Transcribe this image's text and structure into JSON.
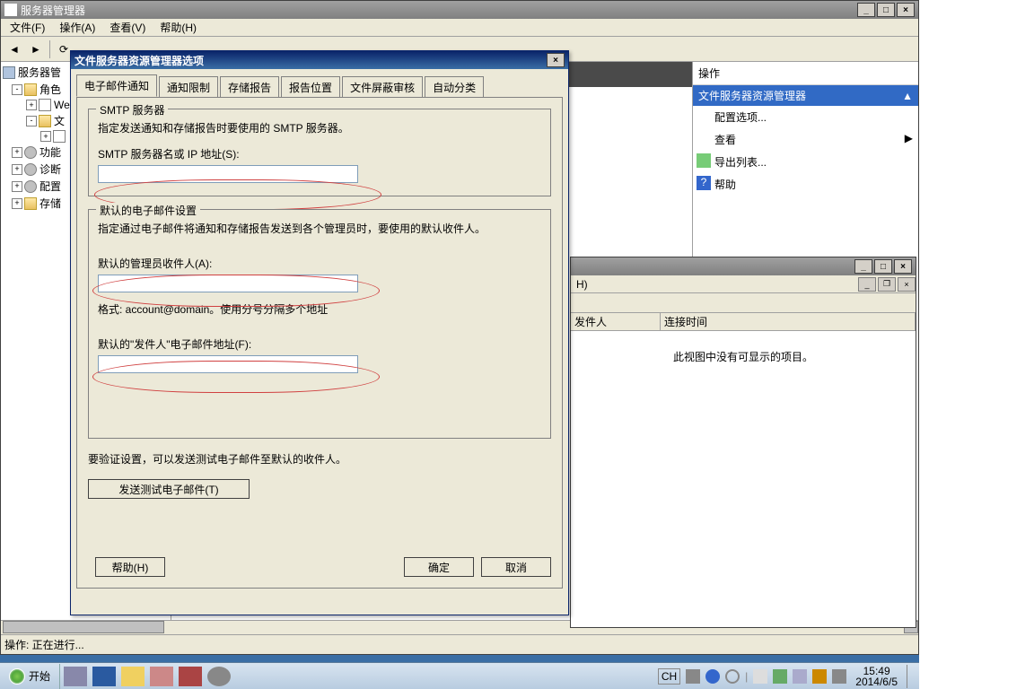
{
  "main": {
    "title": "服务器管理器",
    "menus": [
      "文件(F)",
      "操作(A)",
      "查看(V)",
      "帮助(H)"
    ]
  },
  "tree": {
    "root": "服务器管",
    "roles": "角色",
    "web": "We",
    "file": "文",
    "features": "功能",
    "diag": "诊断",
    "config": "配置",
    "storage": "存储"
  },
  "actions": {
    "header": "操作",
    "section": "文件服务器资源管理器",
    "items": [
      "配置选项...",
      "查看",
      "导出列表...",
      "帮助"
    ]
  },
  "sub": {
    "menu_h": "H)",
    "col1": "发件人",
    "col2": "连接时间",
    "empty": "此视图中没有可显示的项目。"
  },
  "dialog": {
    "title": "文件服务器资源管理器选项",
    "tabs": [
      "电子邮件通知",
      "通知限制",
      "存储报告",
      "报告位置",
      "文件屏蔽审核",
      "自动分类"
    ],
    "smtp": {
      "legend": "SMTP 服务器",
      "desc": "指定发送通知和存储报告时要使用的 SMTP 服务器。",
      "label": "SMTP 服务器名或 IP 地址(S):"
    },
    "defaults": {
      "legend": "默认的电子邮件设置",
      "desc": "指定通过电子邮件将通知和存储报告发送到各个管理员时，要使用的默认收件人。",
      "admin_label": "默认的管理员收件人(A):",
      "format": "格式: account@domain。使用分号分隔多个地址",
      "from_label": "默认的\"发件人\"电子邮件地址(F):"
    },
    "verify": "要验证设置，可以发送测试电子邮件至默认的收件人。",
    "test_btn": "发送测试电子邮件(T)",
    "help_btn": "帮助(H)",
    "ok_btn": "确定",
    "cancel_btn": "取消"
  },
  "status": "操作:  正在进行...",
  "taskbar": {
    "start": "开始",
    "ime": "CH",
    "time": "15:49",
    "date": "2014/6/5"
  }
}
